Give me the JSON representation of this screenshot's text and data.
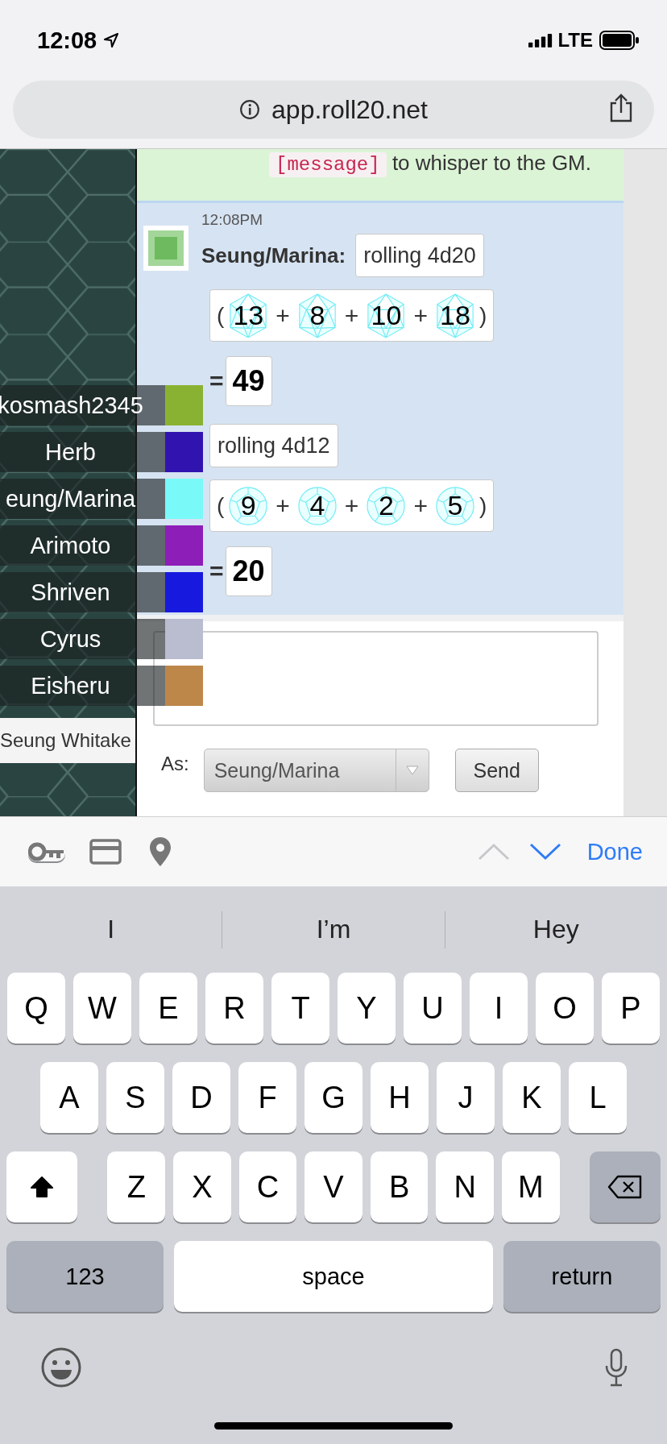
{
  "status_bar": {
    "time": "12:08",
    "network": "LTE"
  },
  "browser": {
    "url": "app.roll20.net"
  },
  "chat": {
    "notice": {
      "code": "[message]",
      "text": "to whisper to the GM."
    },
    "message": {
      "time": "12:08PM",
      "speaker": "Seung/Marina:",
      "rolls": [
        {
          "label": "rolling 4d20",
          "kind": "d20",
          "open": "(",
          "close": ")",
          "op": "+",
          "dice": [
            "13",
            "8",
            "10",
            "18"
          ],
          "equals": "=",
          "total": "49"
        },
        {
          "label": "rolling 4d12",
          "kind": "d12",
          "open": "(",
          "close": ")",
          "op": "+",
          "dice": [
            "9",
            "4",
            "2",
            "5"
          ],
          "equals": "=",
          "total": "20"
        }
      ]
    },
    "input": {
      "as_label": "As:",
      "as_value": "Seung/Marina",
      "send": "Send"
    }
  },
  "players": [
    {
      "name": "kosmash2345",
      "color": "#8ab232"
    },
    {
      "name": "Herb",
      "color": "#3114b0"
    },
    {
      "name": "eung/Marina",
      "color": "#7af9f9"
    },
    {
      "name": "Arimoto",
      "color": "#8e1eb8"
    },
    {
      "name": "Shriven",
      "color": "#1819de"
    },
    {
      "name": "Cyrus",
      "color": "#babcd0"
    },
    {
      "name": "Eisheru",
      "color": "#bd874a"
    }
  ],
  "tooltip": "Seung Whitake",
  "accessory_bar": {
    "done": "Done"
  },
  "suggestions": [
    "I",
    "I’m",
    "Hey"
  ],
  "keyboard": {
    "rows": [
      {
        "keys": [
          {
            "kind": "letter",
            "label": "Q"
          },
          {
            "kind": "letter",
            "label": "W"
          },
          {
            "kind": "letter",
            "label": "E"
          },
          {
            "kind": "letter",
            "label": "R"
          },
          {
            "kind": "letter",
            "label": "T"
          },
          {
            "kind": "letter",
            "label": "Y"
          },
          {
            "kind": "letter",
            "label": "U"
          },
          {
            "kind": "letter",
            "label": "I"
          },
          {
            "kind": "letter",
            "label": "O"
          },
          {
            "kind": "letter",
            "label": "P"
          }
        ]
      },
      {
        "keys": [
          {
            "kind": "letter",
            "label": "A"
          },
          {
            "kind": "letter",
            "label": "S"
          },
          {
            "kind": "letter",
            "label": "D"
          },
          {
            "kind": "letter",
            "label": "F"
          },
          {
            "kind": "letter",
            "label": "G"
          },
          {
            "kind": "letter",
            "label": "H"
          },
          {
            "kind": "letter",
            "label": "J"
          },
          {
            "kind": "letter",
            "label": "K"
          },
          {
            "kind": "letter",
            "label": "L"
          }
        ]
      },
      {
        "keys": [
          {
            "kind": "shift",
            "on": true
          },
          {
            "kind": "letter",
            "label": "Z"
          },
          {
            "kind": "letter",
            "label": "X"
          },
          {
            "kind": "letter",
            "label": "C"
          },
          {
            "kind": "letter",
            "label": "V"
          },
          {
            "kind": "letter",
            "label": "B"
          },
          {
            "kind": "letter",
            "label": "N"
          },
          {
            "kind": "letter",
            "label": "M"
          },
          {
            "kind": "backspace"
          }
        ]
      },
      {
        "keys": [
          {
            "kind": "mode",
            "label": "123"
          },
          {
            "kind": "space",
            "label": "space"
          },
          {
            "kind": "return",
            "label": "return"
          }
        ]
      }
    ]
  }
}
